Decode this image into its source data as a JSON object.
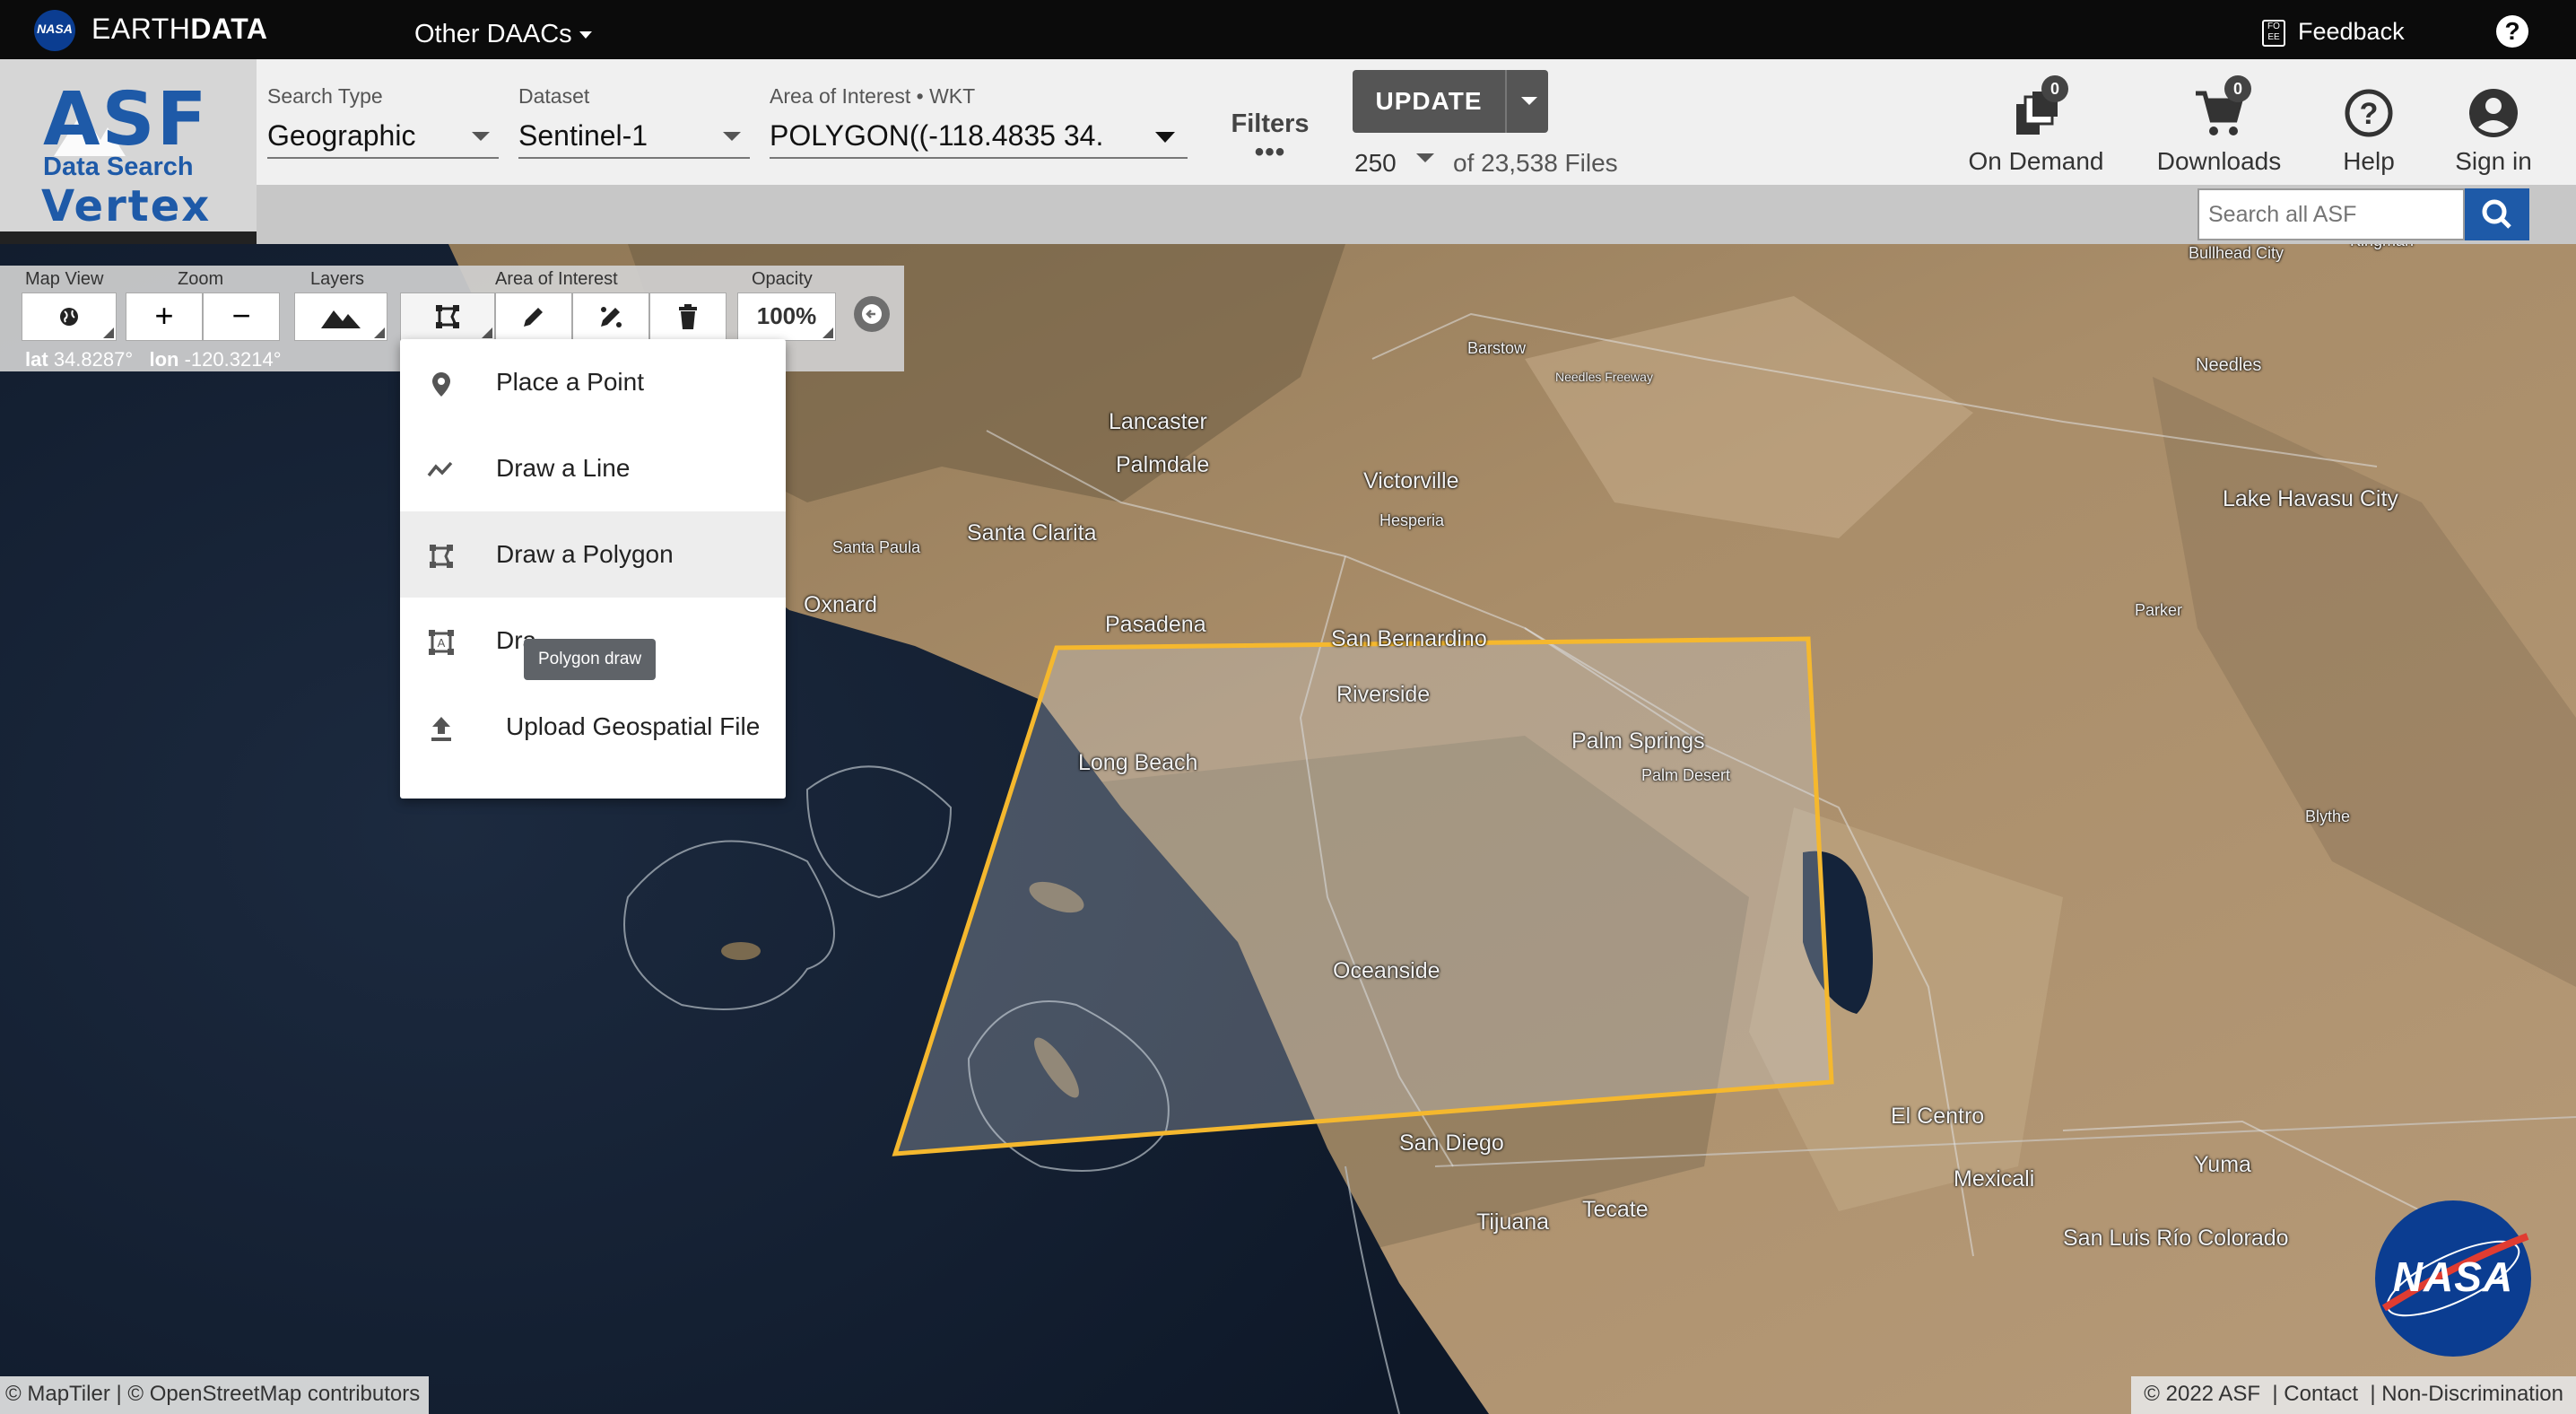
{
  "earthdata_bar": {
    "nasa_badge": "NASA",
    "logo_light": "EARTH",
    "logo_bold": "DATA",
    "other_daacs": "Other DAACs",
    "feedback_icon": "FO EE",
    "feedback": "Feedback",
    "help": "?"
  },
  "asf_logo": {
    "title": "ASF",
    "subtitle": "Data Search",
    "product": "Vertex"
  },
  "search_type": {
    "label": "Search Type",
    "value": "Geographic"
  },
  "dataset": {
    "label": "Dataset",
    "value": "Sentinel-1"
  },
  "aoi": {
    "label": "Area of Interest • WKT",
    "value": "POLYGON((-118.4835 34."
  },
  "filters": {
    "label": "Filters",
    "more": "•••"
  },
  "update": {
    "label": "UPDATE"
  },
  "results": {
    "max": "250",
    "count_text": "of 23,538 Files"
  },
  "header_actions": {
    "on_demand": {
      "label": "On Demand",
      "badge": "0",
      "icon": "on-demand-icon"
    },
    "downloads": {
      "label": "Downloads",
      "badge": "0",
      "icon": "cart-icon"
    },
    "help": {
      "label": "Help",
      "icon": "help-icon"
    },
    "sign_in": {
      "label": "Sign in",
      "icon": "account-icon"
    }
  },
  "asf_search": {
    "placeholder": "Search all ASF"
  },
  "map_toolbar": {
    "labels": {
      "map_view": "Map View",
      "zoom": "Zoom",
      "layers": "Layers",
      "area_of_interest": "Area of Interest",
      "opacity": "Opacity"
    },
    "zoom_in": "+",
    "zoom_out": "−",
    "opacity_value": "100%",
    "lat_label": "lat",
    "lat_value": "34.8287°",
    "lon_label": "lon",
    "lon_value": "-120.3214°"
  },
  "aoi_menu": {
    "items": [
      {
        "label": "Place a Point",
        "icon": "pin-icon"
      },
      {
        "label": "Draw a Line",
        "icon": "line-icon"
      },
      {
        "label": "Draw a Polygon",
        "icon": "polygon-icon",
        "active": true
      },
      {
        "label": "Dra",
        "icon": "box-icon"
      },
      {
        "label": "Upload Geospatial File",
        "icon": "upload-icon"
      }
    ],
    "tooltip": "Polygon draw"
  },
  "map_labels": [
    "Bullhead City",
    "Kingman",
    "Barstow",
    "Needles Freeway",
    "Needles",
    "Lancaster",
    "Palmdale",
    "Victorville",
    "Hesperia",
    "Lake Havasu City",
    "Santa Paula",
    "Santa Clarita",
    "Oxnard",
    "Pasadena",
    "San Bernardino",
    "Riverside",
    "Long Beach",
    "Palm Springs",
    "Palm Desert",
    "Parker",
    "Blythe",
    "Oceanside",
    "El Centro",
    "Mexicali",
    "San Diego",
    "Tecate",
    "Tijuana",
    "Yuma",
    "San Luis Río Colorado"
  ],
  "footer": {
    "attribution": "© MapTiler | © OpenStreetMap contributors",
    "copyright": "© 2022 ASF",
    "contact": "Contact",
    "non_discrimination": "Non-Discrimination",
    "nasa_logo": "NASA"
  },
  "colors": {
    "asf_blue": "#1e5aa8",
    "update_button": "#555555",
    "polygon_stroke": "#f5b82e",
    "topbar": "#0b0b0b"
  }
}
